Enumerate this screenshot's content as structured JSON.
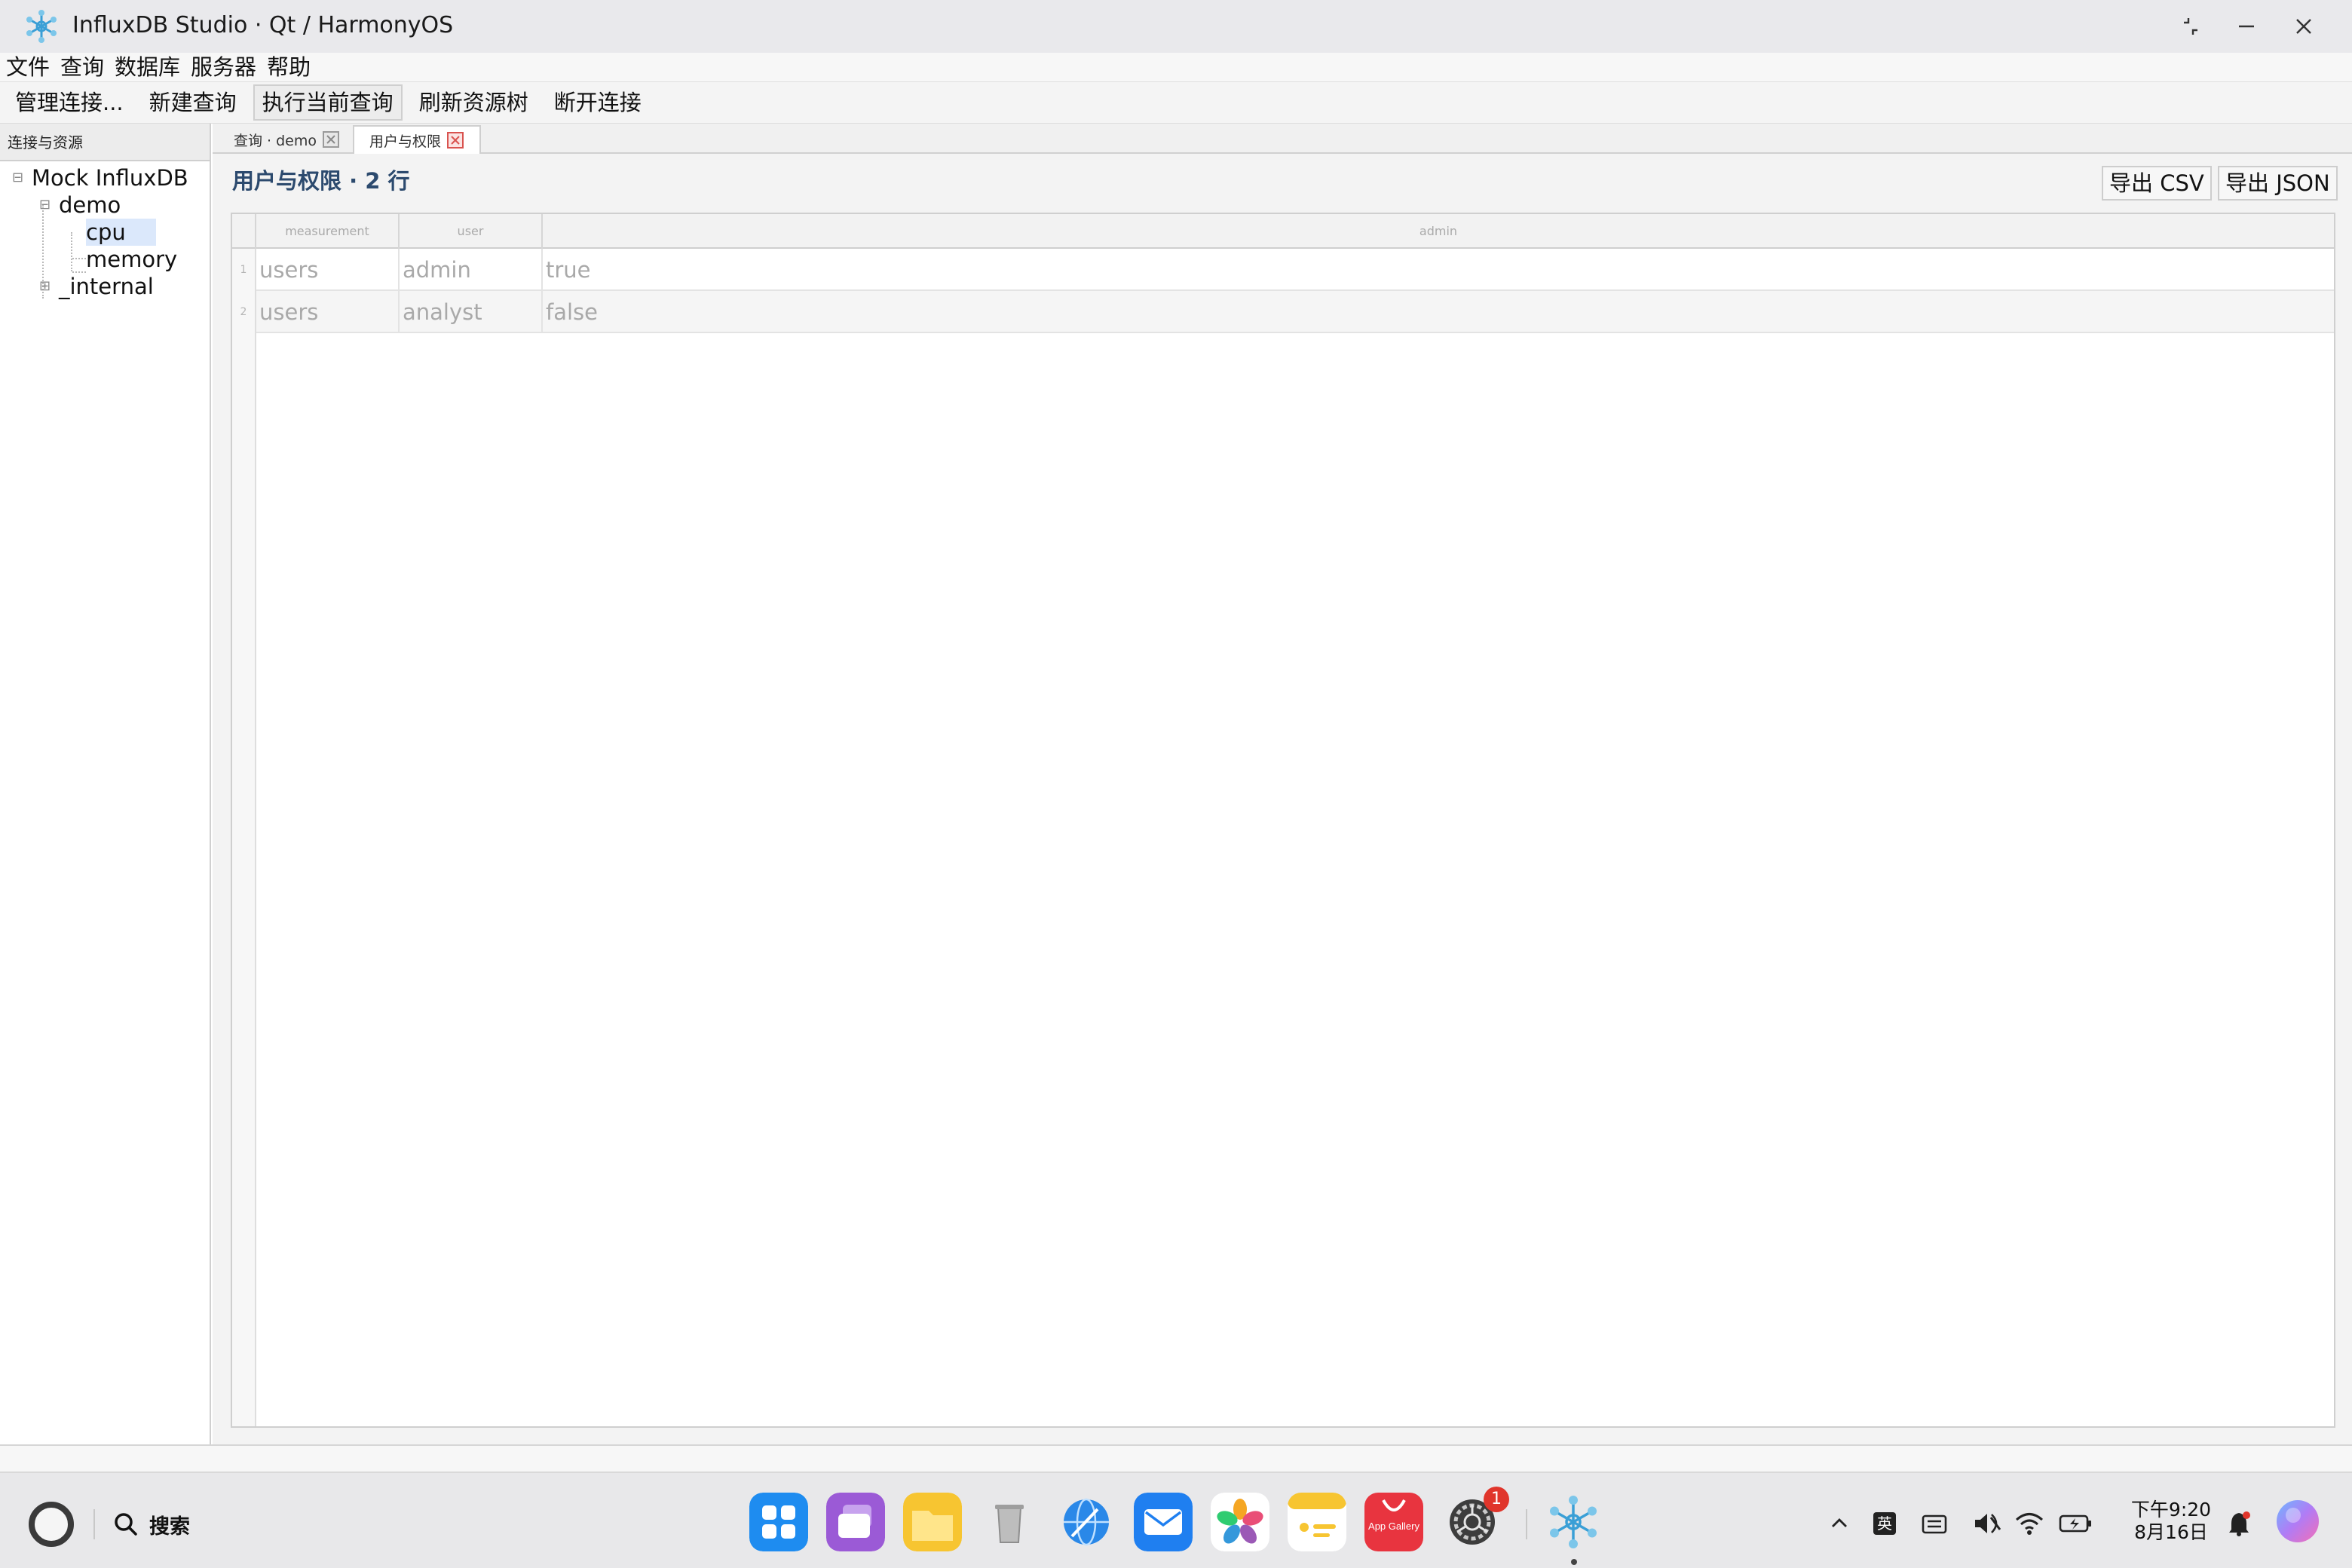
{
  "window": {
    "title": "InfluxDB Studio · Qt / HarmonyOS"
  },
  "menu": [
    "文件",
    "查询",
    "数据库",
    "服务器",
    "帮助"
  ],
  "toolbar": [
    "管理连接...",
    "新建查询",
    "执行当前查询",
    "刷新资源树",
    "断开连接"
  ],
  "dock": {
    "title": "连接与资源",
    "tree": {
      "root": "Mock InfluxDB",
      "db1": "demo",
      "m1": "cpu",
      "m2": "memory",
      "db2": "_internal"
    }
  },
  "tabs": [
    {
      "label": "查询 · demo"
    },
    {
      "label": "用户与权限"
    }
  ],
  "result": {
    "title": "用户与权限 · 2 行",
    "export_csv": "导出 CSV",
    "export_json": "导出 JSON",
    "columns": [
      "measurement",
      "user",
      "admin"
    ],
    "rows": [
      {
        "num": "1",
        "cells": [
          "users",
          "admin",
          "true"
        ]
      },
      {
        "num": "2",
        "cells": [
          "users",
          "analyst",
          "false"
        ]
      }
    ]
  },
  "taskbar": {
    "search_label": "搜索",
    "app_gallery_text": "App Gallery",
    "settings_badge": "1",
    "ime": "英",
    "time": "下午9:20",
    "date": "8月16日"
  }
}
